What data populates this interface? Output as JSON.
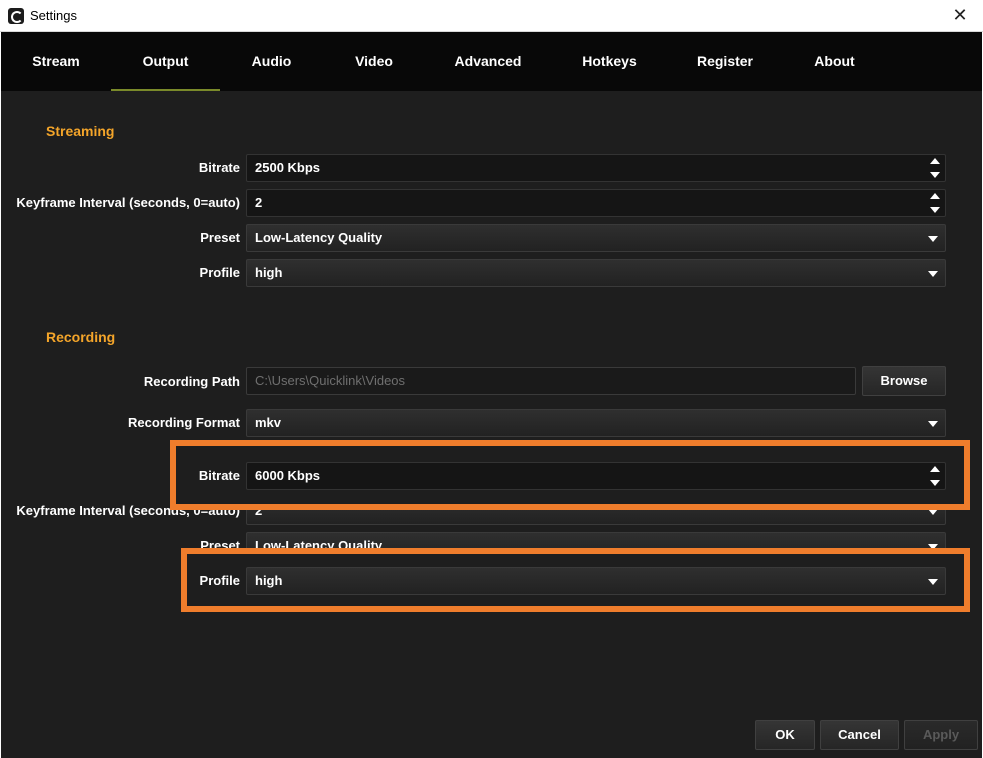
{
  "window": {
    "title": "Settings",
    "close": "✕"
  },
  "tabs": [
    {
      "label": "Stream"
    },
    {
      "label": "Output"
    },
    {
      "label": "Audio"
    },
    {
      "label": "Video"
    },
    {
      "label": "Advanced"
    },
    {
      "label": "Hotkeys"
    },
    {
      "label": "Register"
    },
    {
      "label": "About"
    }
  ],
  "active_tab": "Output",
  "streaming": {
    "title": "Streaming",
    "bitrate": {
      "label": "Bitrate",
      "value": "2500 Kbps"
    },
    "keyframe": {
      "label": "Keyframe Interval (seconds, 0=auto)",
      "value": "2"
    },
    "preset": {
      "label": "Preset",
      "value": "Low-Latency Quality"
    },
    "profile": {
      "label": "Profile",
      "value": "high"
    }
  },
  "recording": {
    "title": "Recording",
    "path": {
      "label": "Recording Path",
      "value": "C:\\Users\\Quicklink\\Videos",
      "browse": "Browse"
    },
    "format": {
      "label": "Recording Format",
      "value": "mkv"
    },
    "bitrate": {
      "label": "Bitrate",
      "value": "6000 Kbps"
    },
    "keyframe": {
      "label": "Keyframe Interval (seconds, 0=auto)",
      "value": "2"
    },
    "preset": {
      "label": "Preset",
      "value": "Low-Latency Quality"
    },
    "profile": {
      "label": "Profile",
      "value": "high"
    }
  },
  "footer": {
    "ok": "OK",
    "cancel": "Cancel",
    "apply": "Apply"
  },
  "colors": {
    "section_accent": "#f4a52a",
    "highlight": "#ef7d2c",
    "background": "#1e1e1e",
    "tabbar": "#080808"
  }
}
